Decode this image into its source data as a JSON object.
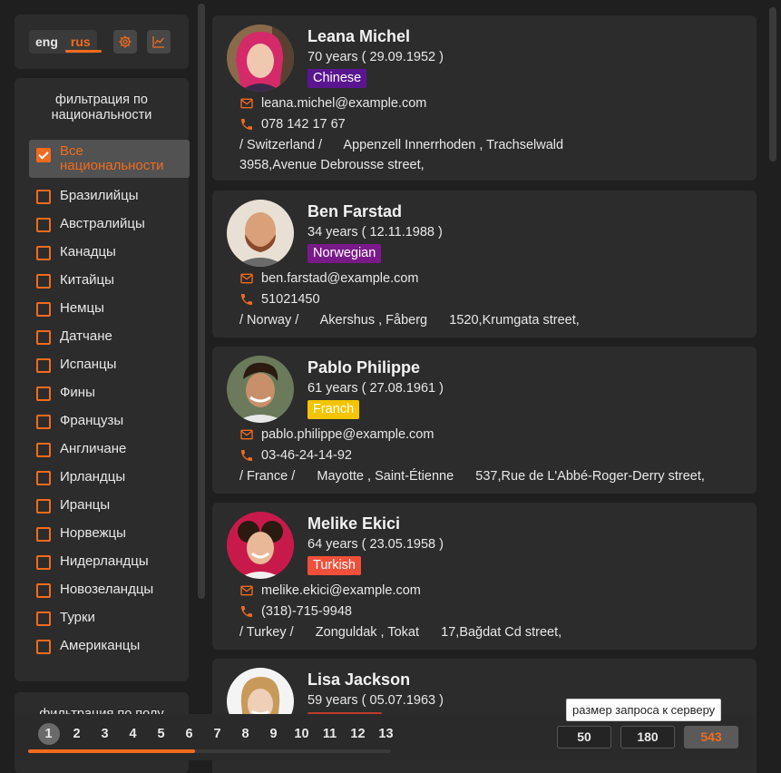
{
  "settings": {
    "lang_eng": "eng",
    "lang_rus": "rus",
    "settings_icon": "gear-icon",
    "stats_icon": "chart-icon"
  },
  "filter": {
    "title": "фильтрация по национальности",
    "items": [
      {
        "label": "Все национальности",
        "checked": true
      },
      {
        "label": "Бразилийцы",
        "checked": false
      },
      {
        "label": "Австралийцы",
        "checked": false
      },
      {
        "label": "Канадцы",
        "checked": false
      },
      {
        "label": "Китайцы",
        "checked": false
      },
      {
        "label": "Немцы",
        "checked": false
      },
      {
        "label": "Датчане",
        "checked": false
      },
      {
        "label": "Испанцы",
        "checked": false
      },
      {
        "label": "Фины",
        "checked": false
      },
      {
        "label": "Французы",
        "checked": false
      },
      {
        "label": "Англичане",
        "checked": false
      },
      {
        "label": "Ирландцы",
        "checked": false
      },
      {
        "label": "Иранцы",
        "checked": false
      },
      {
        "label": "Норвежцы",
        "checked": false
      },
      {
        "label": "Нидерландцы",
        "checked": false
      },
      {
        "label": "Новозеландцы",
        "checked": false
      },
      {
        "label": "Турки",
        "checked": false
      },
      {
        "label": "Американцы",
        "checked": false
      }
    ]
  },
  "gender_filter": {
    "title": "фильтрация по полу"
  },
  "accent_color": "#f26b1d",
  "users": [
    {
      "name": "Leana Michel",
      "age": "70 years ( 29.09.1952 )",
      "nationality": "Chinese",
      "nat_bg": "#5a1690",
      "nat_fg": "#ffffff",
      "email": "leana.michel@example.com",
      "phone": "078 142 17 67",
      "address_line1": "/ Switzerland /      Appenzell Innerrhoden , Trachselwald",
      "address_line2": "3958,Avenue Debrousse street,"
    },
    {
      "name": "Ben Farstad",
      "age": "34 years ( 12.11.1988 )",
      "nationality": "Norwegian",
      "nat_bg": "#7a1a8a",
      "nat_fg": "#ffffff",
      "email": "ben.farstad@example.com",
      "phone": "51021450",
      "address_line1": "/ Norway /      Akershus , Fåberg      1520,Krumgata street,",
      "address_line2": ""
    },
    {
      "name": "Pablo Philippe",
      "age": "61 years ( 27.08.1961 )",
      "nationality": "Franch",
      "nat_bg": "#f5c400",
      "nat_fg": "#ffffff",
      "email": "pablo.philippe@example.com",
      "phone": "03-46-24-14-92",
      "address_line1": "/ France /      Mayotte , Saint-Étienne      537,Rue de L'Abbé-Roger-Derry street,",
      "address_line2": ""
    },
    {
      "name": "Melike Ekici",
      "age": "64 years ( 23.05.1958 )",
      "nationality": "Turkish",
      "nat_bg": "#f0503a",
      "nat_fg": "#ffffff",
      "email": "melike.ekici@example.com",
      "phone": "(318)-715-9948",
      "address_line1": "/ Turkey /      Zonguldak , Tokat      17,Bağdat Cd street,",
      "address_line2": ""
    },
    {
      "name": "Lisa Jackson",
      "age": "59 years ( 05.07.1963 )",
      "nationality": "",
      "nat_bg": "#c0392b",
      "nat_fg": "#ffffff",
      "email": "",
      "phone": "",
      "address_line1": "",
      "address_line2": ""
    }
  ],
  "pagination": {
    "pages": [
      "1",
      "2",
      "3",
      "4",
      "5",
      "6",
      "7",
      "8",
      "9",
      "10",
      "11",
      "12",
      "13"
    ],
    "current": "1"
  },
  "request_size": {
    "tooltip": "размер запроса к серверу",
    "options": [
      "50",
      "180",
      "543"
    ],
    "selected": "543"
  }
}
